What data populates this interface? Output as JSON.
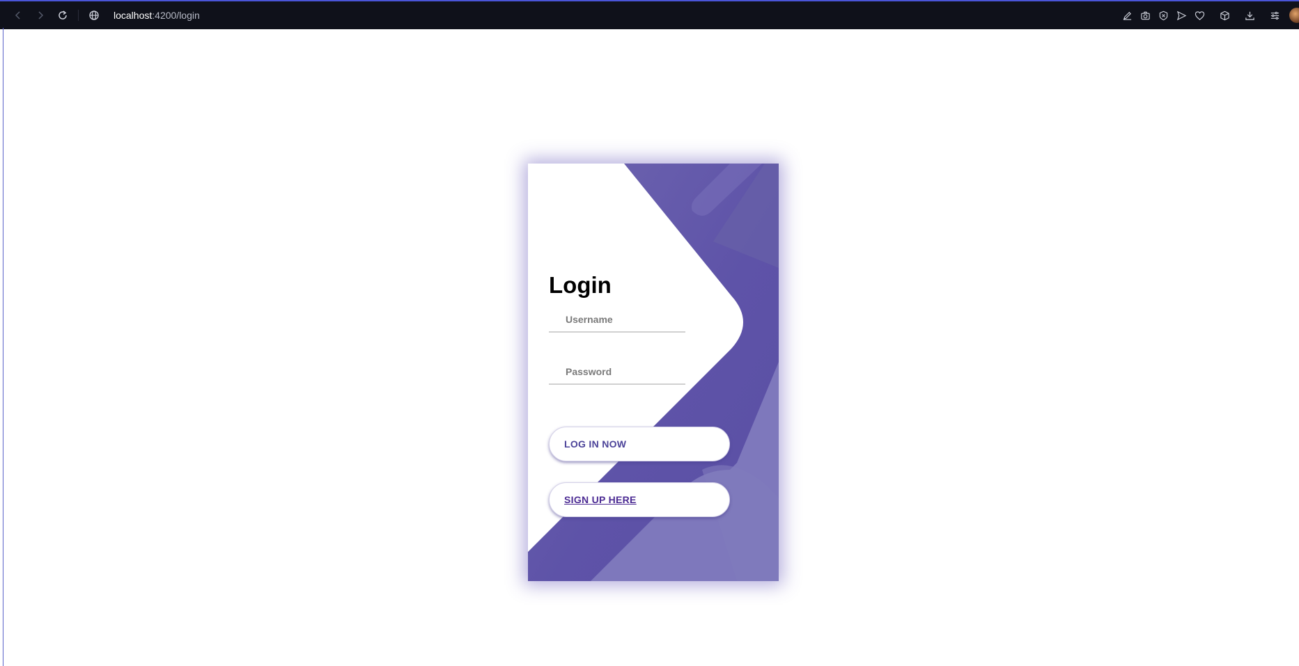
{
  "browser": {
    "url_host": "localhost",
    "url_path": ":4200/login"
  },
  "login": {
    "title": "Login",
    "username_placeholder": "Username",
    "password_placeholder": "Password",
    "login_button": "LOG IN NOW",
    "signup_link": "SIGN UP HERE"
  },
  "colors": {
    "accent": "#6a5fb0",
    "accent_dark": "#5d52a6",
    "accent_light": "#7f78bc",
    "button_text": "#4c4399",
    "browser_bg": "#0f111a"
  }
}
